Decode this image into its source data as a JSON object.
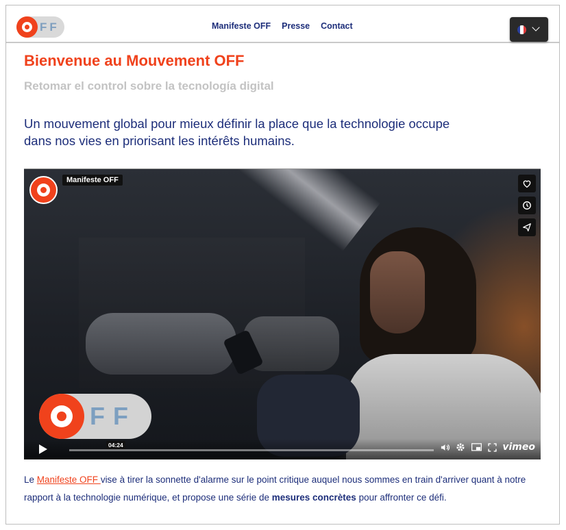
{
  "brand": {
    "logo_letters": "FF",
    "accent": "#f0421c",
    "navy": "#1d2e7a",
    "gray_text": "#c3c3c3"
  },
  "nav": {
    "items": [
      "Manifeste OFF",
      "Presse",
      "Contact"
    ]
  },
  "language": {
    "flag_icon": "france-flag-icon",
    "dropdown_icon": "chevron-down-icon"
  },
  "hero": {
    "title": "Bienvenue au Mouvement OFF",
    "subtitle": "Retomar el control sobre la tecnología digital",
    "lead": "Un mouvement global pour mieux définir la place que la technologie occupe dans nos vies en priorisant les intérêts humains."
  },
  "video": {
    "channel_chip": "Manifeste OFF",
    "overlay_logo_letters": "FF",
    "time": "04:24",
    "brand": "vimeo",
    "side_buttons": [
      "heart-icon",
      "clock-icon",
      "send-icon"
    ],
    "controls": [
      "play-icon",
      "volume-icon",
      "settings-icon",
      "pip-icon",
      "fullscreen-icon"
    ]
  },
  "intro": {
    "prefix": "Le ",
    "link": "Manifeste OFF ",
    "middle": "vise à tirer la sonnette d'alarme sur le point critique auquel nous sommes en train d'arriver quant à notre rapport à la technologie numérique, et propose une série de ",
    "bold": "mesures concrètes",
    "suffix": " pour affronter ce défi."
  }
}
